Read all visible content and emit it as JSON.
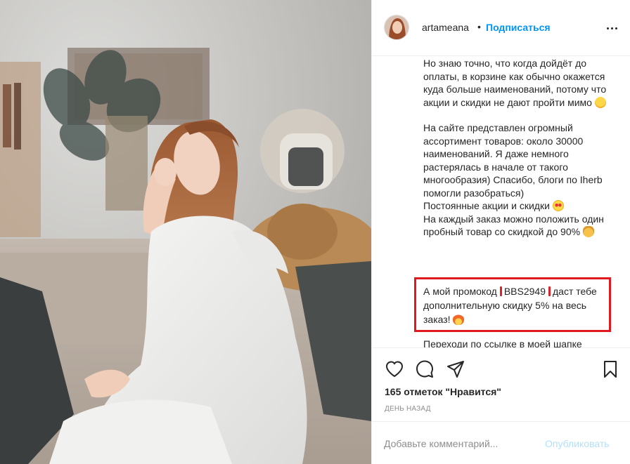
{
  "post": {
    "username": "artameana",
    "separator": "•",
    "follow_label": "Подписаться",
    "more_icon": "more-horizontal-icon"
  },
  "caption": {
    "paragraph_1": "Но знаю точно, что когда дойдёт до оплаты, в корзине как обычно окажется куда больше наименований, потому что акции и скидки не дают пройти мимо",
    "paragraph_2_a": "На сайте представлен огромный ассортимент товаров: около 30000 наименований. Я даже немного растерялась в начале от такого многообразия) Спасибо, блоги по Iherb помогли разобраться)",
    "paragraph_2_b": "Постоянные акции и скидки",
    "paragraph_2_c": "На каждый заказ можно положить один пробный товар со скидкой до 90%",
    "promo_before": "А мой промокод",
    "promo_code": "BBS2949",
    "promo_after": "даст тебе дополнительную скидку 5% на весь заказ!",
    "cut_line": "Переходи по ссылке в моей шапке"
  },
  "actions": {
    "like_icon": "heart-icon",
    "comment_icon": "comment-icon",
    "share_icon": "share-icon",
    "save_icon": "bookmark-icon",
    "likes_text": "165 отметок \"Нравится\"",
    "timestamp": "ДЕНЬ НАЗАД"
  },
  "comment": {
    "placeholder": "Добавьте комментарий...",
    "publish_label": "Опубликовать"
  },
  "colors": {
    "accent_blue": "#0095f6",
    "disabled_blue": "#b2dffc",
    "highlight_red": "#e0181f",
    "text": "#262626",
    "muted": "#8e8e8e"
  }
}
